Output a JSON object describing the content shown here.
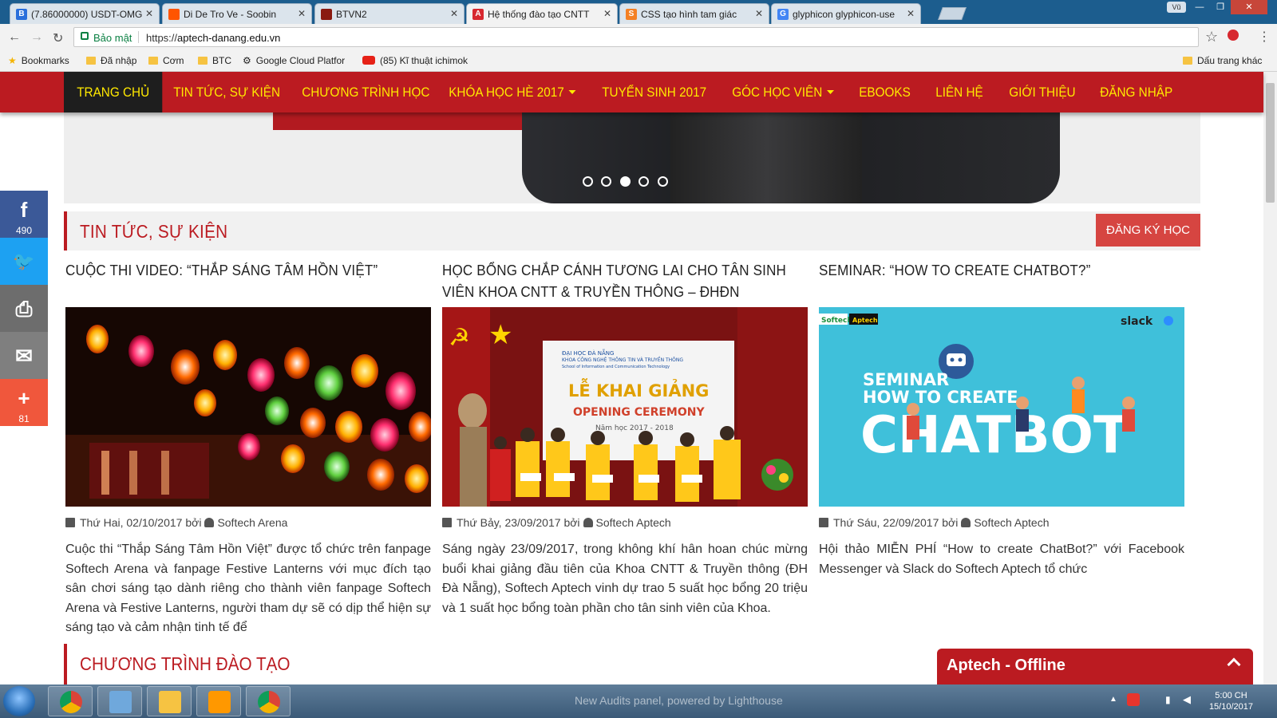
{
  "browser": {
    "tabs": [
      {
        "title": "(7.86000000) USDT-OMG",
        "icon": "bittrex-icon",
        "color": "#2a6fdb",
        "letter": "B"
      },
      {
        "title": "Di De Tro Ve - Soobin",
        "icon": "soundcloud-icon",
        "color": "#ff5500",
        "letter": ""
      },
      {
        "title": "BTVN2",
        "icon": "dota-icon",
        "color": "#8a1a10",
        "letter": ""
      },
      {
        "title": "Hệ thống đào tạo CNTT",
        "icon": "aptech-icon",
        "color": "#d7282f",
        "letter": "A"
      },
      {
        "title": "CSS tạo hình tam giác",
        "icon": "stackoverflow-icon",
        "color": "#f48024",
        "letter": "S"
      },
      {
        "title": "glyphicon glyphicon-use",
        "icon": "google-icon",
        "color": "#4285f4",
        "letter": "G"
      }
    ],
    "user_chip": "Vũ",
    "secure_label": "Bảo mật",
    "url_scheme": "https://",
    "url_host": "aptech-danang.edu.vn",
    "bookmarks": [
      {
        "label": "Bookmarks",
        "icon": "star-icon"
      },
      {
        "label": "Đã nhập",
        "icon": "folder-icon"
      },
      {
        "label": "Cơm",
        "icon": "folder-icon"
      },
      {
        "label": "BTC",
        "icon": "folder-icon"
      },
      {
        "label": "Google Cloud Platfor",
        "icon": "gear-icon"
      },
      {
        "label": "(85) Kĩ thuật ichimok",
        "icon": "youtube-icon"
      }
    ],
    "other_bookmarks": "Dấu trang khác"
  },
  "site": {
    "nav": [
      {
        "label": "TRANG CHỦ",
        "active": true,
        "caret": false
      },
      {
        "label": "TIN TỨC, SỰ KIỆN",
        "active": false,
        "caret": false
      },
      {
        "label": "CHƯƠNG TRÌNH HỌC",
        "active": false,
        "caret": false
      },
      {
        "label": "KHÓA HỌC HÈ 2017",
        "active": false,
        "caret": true
      },
      {
        "label": "TUYỂN SINH 2017",
        "active": false,
        "caret": false
      },
      {
        "label": "GÓC HỌC VIÊN",
        "active": false,
        "caret": true
      },
      {
        "label": "EBOOKS",
        "active": false,
        "caret": false
      },
      {
        "label": "LIÊN HỆ",
        "active": false,
        "caret": false
      },
      {
        "label": "GIỚI THIỆU",
        "active": false,
        "caret": false
      },
      {
        "label": "ĐĂNG NHẬP",
        "active": false,
        "caret": false
      }
    ],
    "slider": {
      "count": 5,
      "active_index": 2
    },
    "news_section": {
      "title": "TIN TỨC, SỰ KIỆN",
      "register_label": "ĐĂNG KÝ HỌC",
      "posts": [
        {
          "title": "CUỘC THI VIDEO: “THẮP SÁNG TÂM HỒN VIỆT”",
          "date": "Thứ Hai, 02/10/2017",
          "by": "bởi",
          "author": "Softech Arena",
          "excerpt": "Cuộc thi “Thắp Sáng Tâm Hồn Việt” được tổ chức trên fanpage Softech Arena và fanpage Festive Lanterns với mục đích tạo sân chơi sáng tạo dành riêng cho thành viên fanpage Softech Arena và Festive Lanterns, người tham dự sẽ có dịp thể hiện sự sáng tạo và cảm nhận tinh tế để"
        },
        {
          "title": "HỌC BỔNG CHẮP CÁNH TƯƠNG LAI CHO TÂN SINH VIÊN KHOA CNTT & TRUYỀN THÔNG – ĐHĐN",
          "date": "Thứ Bảy, 23/09/2017",
          "by": "bởi",
          "author": "Softech Aptech",
          "excerpt": "Sáng ngày 23/09/2017, trong không khí hân hoan chúc mừng buổi khai giảng đầu tiên của Khoa CNTT & Truyền thông (ĐH Đà Nẵng), Softech Aptech vinh dự trao 5 suất học bổng 20 triệu và 1 suất học bổng toàn phần cho tân sinh viên của Khoa.",
          "image_text": {
            "university": "ĐẠI HỌC ĐÀ NẴNG",
            "faculty": "KHOA CÔNG NGHỆ THÔNG TIN VÀ TRUYỀN THÔNG",
            "school_en": "School of Information and Communication Technology",
            "heading_vi": "LỄ KHAI GIẢNG",
            "heading_en": "OPENING CEREMONY",
            "year": "Năm học 2017 - 2018"
          }
        },
        {
          "title": "SEMINAR: “HOW TO CREATE CHATBOT?”",
          "date": "Thứ Sáu, 22/09/2017",
          "by": "bởi",
          "author": "Softech Aptech",
          "excerpt": "Hội thảo MIỄN PHÍ “How to create ChatBot?” với Facebook Messenger và Slack do Softech Aptech tổ chức",
          "image_text": {
            "logo1": "Softech",
            "logo2": "Aptech",
            "slack": "slack",
            "line1": "SEMINAR",
            "line2": "HOW TO CREATE",
            "line3": "CHATBOT"
          }
        }
      ]
    },
    "program_section": {
      "title": "CHƯƠNG TRÌNH ĐÀO TẠO"
    },
    "share": [
      {
        "icon": "facebook-icon",
        "glyph": "f",
        "count": "490",
        "color": "#3b5998"
      },
      {
        "icon": "twitter-icon",
        "glyph": "🐦",
        "count": "",
        "color": "#1da1f2"
      },
      {
        "icon": "print-icon",
        "glyph": "⎙",
        "count": "",
        "color": "#6d6d6d"
      },
      {
        "icon": "email-icon",
        "glyph": "✉",
        "count": "",
        "color": "#7f7f7f"
      },
      {
        "icon": "more-icon",
        "glyph": "+",
        "count": "81",
        "color": "#f0573c"
      }
    ],
    "chat": {
      "title": "Aptech - Offline"
    }
  },
  "taskbar": {
    "bg_text": "New Audits panel, powered by Lighthouse",
    "clock_time": "5:00 CH",
    "clock_date": "15/10/2017"
  },
  "colors": {
    "brand_red": "#bb1b21",
    "nav_text": "#ffe900"
  }
}
